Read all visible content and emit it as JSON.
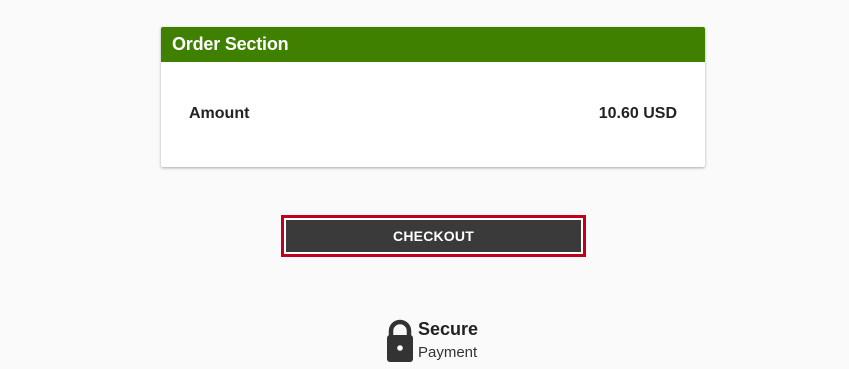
{
  "order_card": {
    "title": "Order Section",
    "amount_label": "Amount",
    "amount_value": "10.60 USD"
  },
  "checkout": {
    "label": "CHECKOUT"
  },
  "secure": {
    "title": "Secure",
    "subtitle": "Payment",
    "icon": "lock-icon"
  },
  "colors": {
    "header_green": "#408000",
    "button_dark": "#3a3a3a",
    "focus_red": "#c0001a",
    "background": "#fafafa"
  }
}
